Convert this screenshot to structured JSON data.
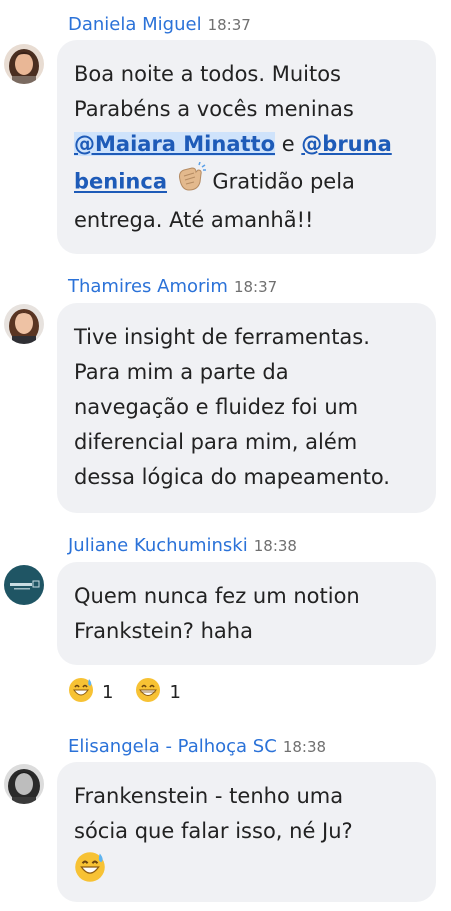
{
  "messages": [
    {
      "name": "Daniela Miguel",
      "time": "18:37",
      "text_1": "Boa noite a todos. Muitos",
      "text_2": "Parabéns a vocês meninas",
      "mention_1": "@Maiara Minatto",
      "connector": "e",
      "mention_2a": "@bruna",
      "mention_2b": "beninca",
      "text_3": "Gratidão pela",
      "text_4": "entrega. Até amanhã!!",
      "inline_emoji": "clapping-hands"
    },
    {
      "name": "Thamires Amorim",
      "time": "18:37",
      "lines": [
        "Tive insight de ferramentas.",
        "Para mim a parte da",
        "navegação e fluidez foi um",
        "diferencial para mim, além",
        "dessa lógica do mapeamento."
      ]
    },
    {
      "name": "Juliane Kuchuminski",
      "time": "18:38",
      "lines": [
        "Quem nunca fez um notion",
        "Frankstein? haha"
      ],
      "reactions": [
        {
          "emoji": "grinning-sweat",
          "count": "1"
        },
        {
          "emoji": "grinning-face",
          "count": "1"
        }
      ]
    },
    {
      "name": "Elisangela - Palhoça SC",
      "time": "18:38",
      "lines": [
        "Frankenstein - tenho uma",
        "sócia que falar isso, né Ju?"
      ],
      "trailing_emoji": "grinning-sweat"
    }
  ],
  "colors": {
    "name": "#2b72d8",
    "bubble": "#f0f1f4",
    "mention": "#1e5bb8",
    "mention_highlight": "#cfe3fb"
  }
}
